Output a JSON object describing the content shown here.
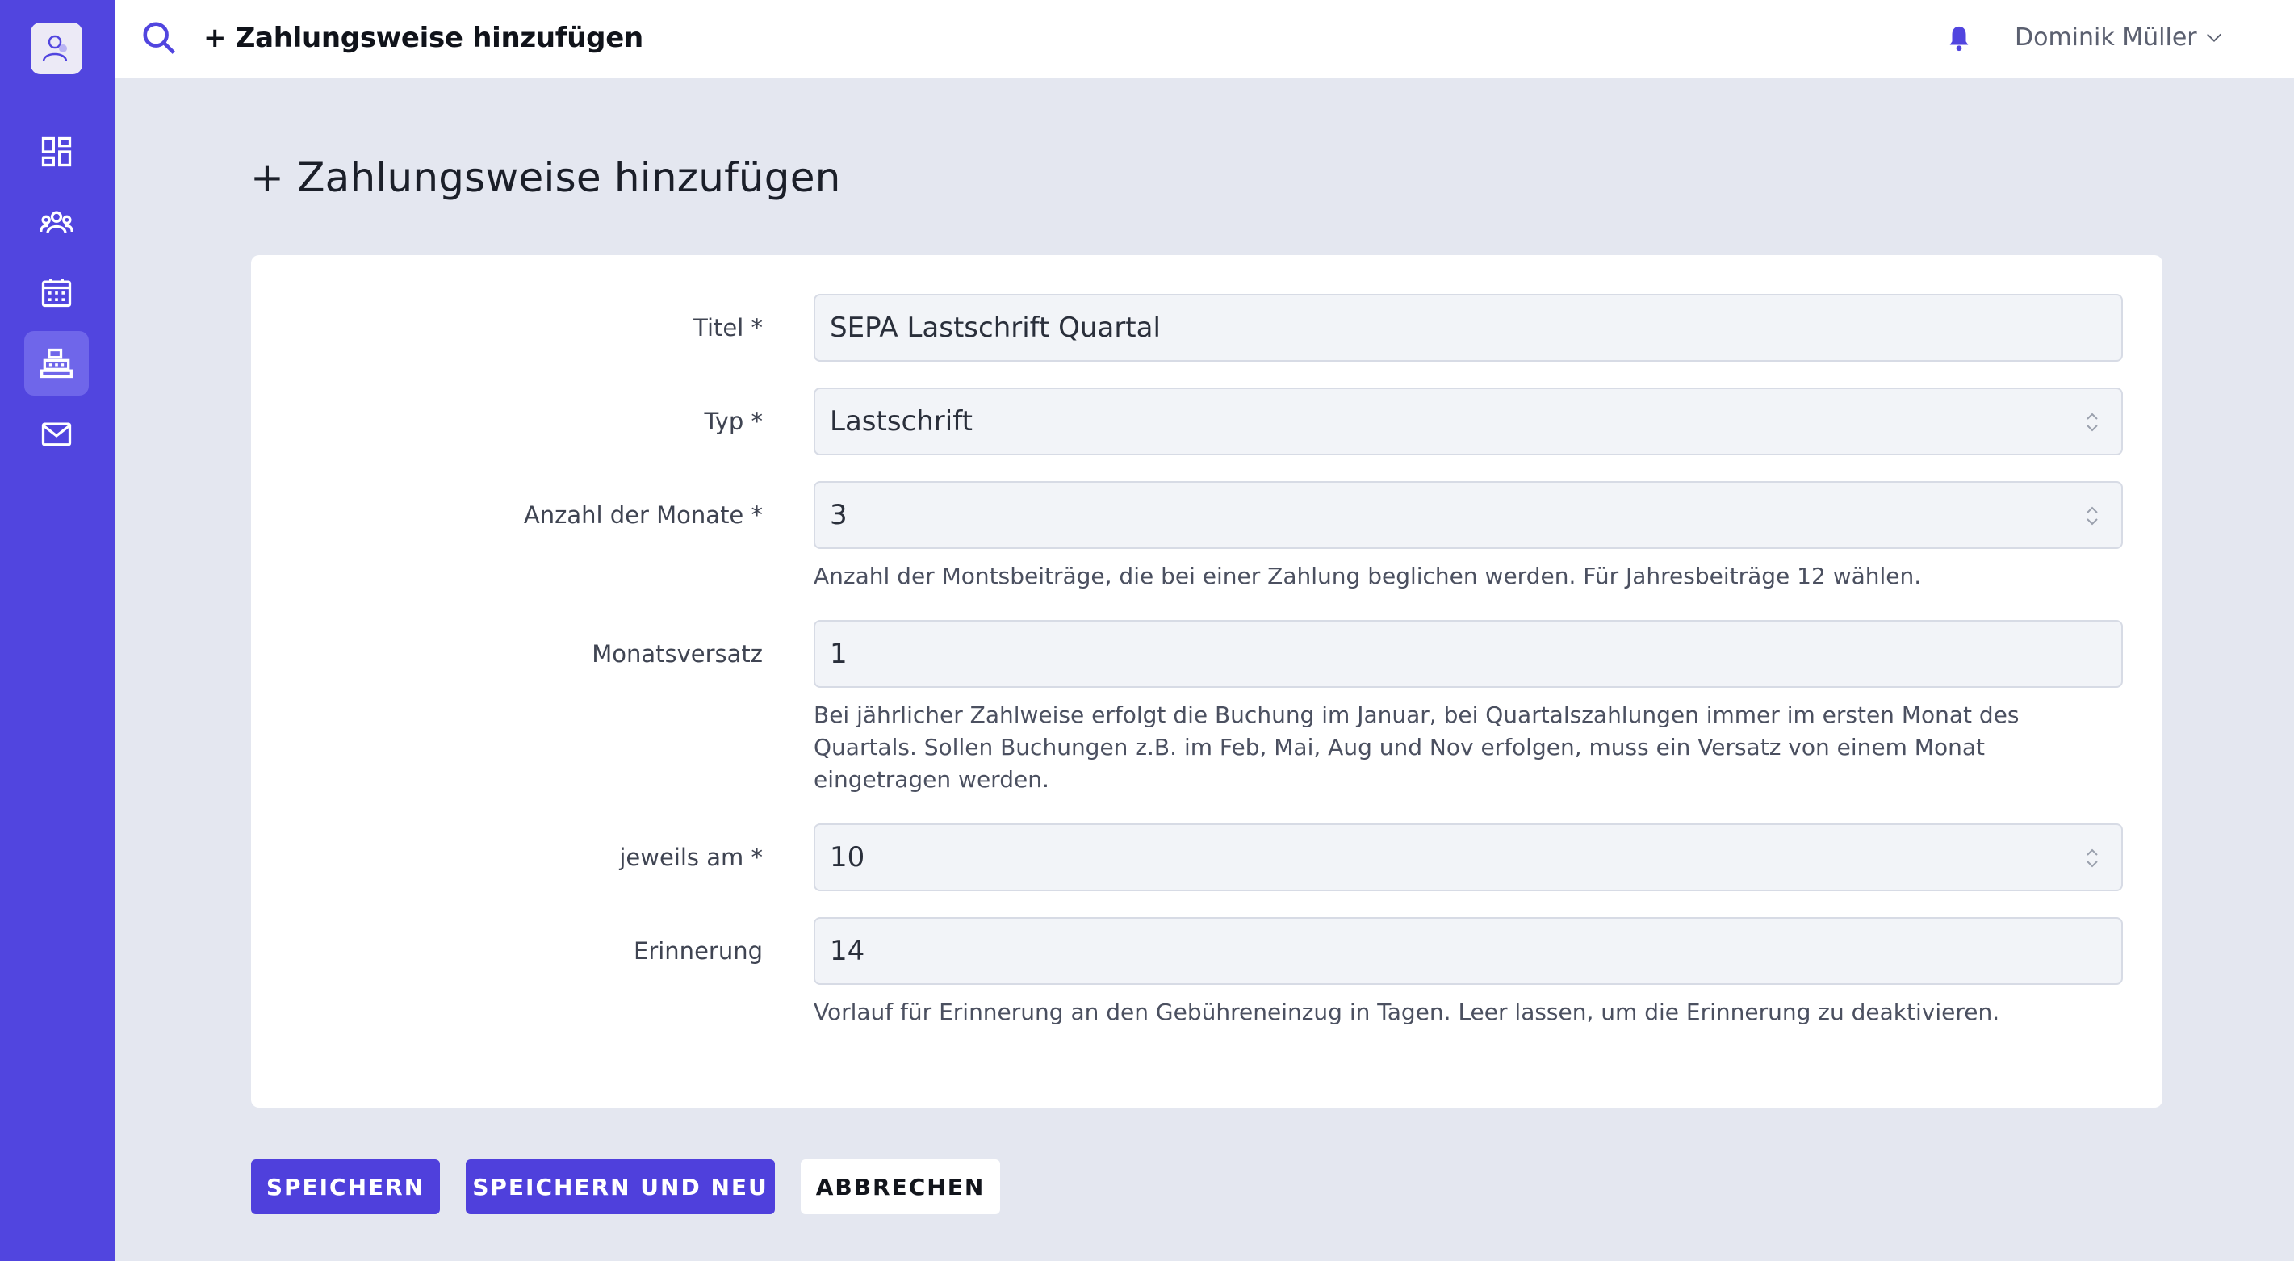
{
  "colors": {
    "sidebar": "#5145df",
    "accent": "#4f40dc",
    "background": "#e4e7f0"
  },
  "sidebar": {
    "logo_icon": "club-logo-icon",
    "items": [
      {
        "icon": "dashboard-icon",
        "active": false
      },
      {
        "icon": "members-icon",
        "active": false
      },
      {
        "icon": "calendar-icon",
        "active": false
      },
      {
        "icon": "cash-register-icon",
        "active": true
      },
      {
        "icon": "mail-icon",
        "active": false
      }
    ]
  },
  "header": {
    "title": "+ Zahlungsweise hinzufügen",
    "user_name": "Dominik Müller"
  },
  "page": {
    "title": "+ Zahlungsweise hinzufügen"
  },
  "form": {
    "titel": {
      "label": "Titel *",
      "value": "SEPA Lastschrift Quartal"
    },
    "typ": {
      "label": "Typ *",
      "value": "Lastschrift"
    },
    "monate": {
      "label": "Anzahl der Monate *",
      "value": "3",
      "help": "Anzahl der Montsbeiträge, die bei einer Zahlung beglichen werden. Für Jahresbeiträge 12 wählen."
    },
    "versatz": {
      "label": "Monatsversatz",
      "value": "1",
      "help": "Bei jährlicher Zahlweise erfolgt die Buchung im Januar, bei Quartalszahlungen immer im ersten Monat des Quartals. Sollen Buchungen z.B. im Feb, Mai, Aug und Nov erfolgen, muss ein Versatz von einem Monat eingetragen werden."
    },
    "tag": {
      "label": "jeweils am *",
      "value": "10"
    },
    "erinnerung": {
      "label": "Erinnerung",
      "value": "14",
      "help": "Vorlauf für Erinnerung an den Gebühreneinzug in Tagen. Leer lassen, um die Erinnerung zu deaktivieren."
    }
  },
  "actions": {
    "save": "SPEICHERN",
    "save_new": "SPEICHERN UND NEU",
    "cancel": "ABBRECHEN"
  }
}
